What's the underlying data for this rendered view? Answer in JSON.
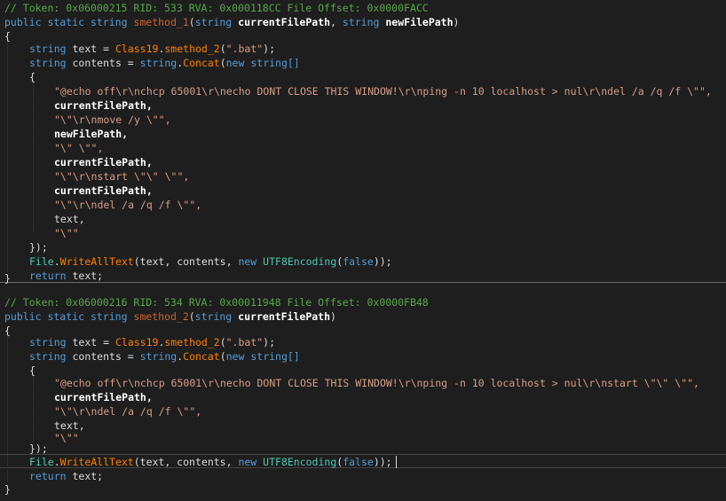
{
  "editor": {
    "current_line_highlight": "line-31",
    "blocks": [
      {
        "token_comment": "// Token: 0x06000215 RID: 533 RVA: 0x000118CC File Offset: 0x0000FACC",
        "signature": {
          "modifiers": "public static",
          "return_type": "string",
          "name": "smethod_1",
          "params": [
            {
              "type": "string",
              "name": "currentFilePath"
            },
            {
              "type": "string",
              "name": "newFilePath"
            }
          ]
        },
        "text_assign": {
          "type": "string",
          "var": "text",
          "class": "Class19",
          "method": "smethod_2",
          "arg": "\".bat\""
        },
        "contents_decl": {
          "type": "string",
          "var": "contents",
          "class": "string",
          "method": "Concat",
          "newkw": "new",
          "arrtype": "string[]"
        },
        "concat_items": [
          {
            "kind": "str",
            "value": "\"@echo off\\r\\nchcp 65001\\r\\necho DONT CLOSE THIS WINDOW!\\r\\nping -n 10 localhost > nul\\r\\ndel /a /q /f \\\"\","
          },
          {
            "kind": "param",
            "value": "currentFilePath,"
          },
          {
            "kind": "str",
            "value": "\"\\\"\\r\\nmove /y \\\"\","
          },
          {
            "kind": "param",
            "value": "newFilePath,"
          },
          {
            "kind": "str",
            "value": "\"\\\" \\\"\","
          },
          {
            "kind": "param",
            "value": "currentFilePath,"
          },
          {
            "kind": "str",
            "value": "\"\\\"\\r\\nstart \\\"\\\" \\\"\","
          },
          {
            "kind": "param",
            "value": "currentFilePath,"
          },
          {
            "kind": "str",
            "value": "\"\\\"\\r\\ndel /a /q /f \\\"\","
          },
          {
            "kind": "var",
            "value": "text,"
          },
          {
            "kind": "str",
            "value": "\"\\\"\""
          }
        ],
        "write_call": {
          "class": "File",
          "method": "WriteAllText",
          "args": "(text, contents,",
          "newkw": "new",
          "enc": "UTF8Encoding",
          "flag": "false",
          "end": "));"
        },
        "return_stmt": {
          "kw": "return",
          "value": "text;"
        }
      },
      {
        "token_comment": "// Token: 0x06000216 RID: 534 RVA: 0x00011948 File Offset: 0x0000FB48",
        "signature": {
          "modifiers": "public static",
          "return_type": "string",
          "name": "smethod_2",
          "params": [
            {
              "type": "string",
              "name": "currentFilePath"
            }
          ]
        },
        "text_assign": {
          "type": "string",
          "var": "text",
          "class": "Class19",
          "method": "smethod_2",
          "arg": "\".bat\""
        },
        "contents_decl": {
          "type": "string",
          "var": "contents",
          "class": "string",
          "method": "Concat",
          "newkw": "new",
          "arrtype": "string[]"
        },
        "concat_items": [
          {
            "kind": "str",
            "value": "\"@echo off\\r\\nchcp 65001\\r\\necho DONT CLOSE THIS WINDOW!\\r\\nping -n 10 localhost > nul\\r\\nstart \\\"\\\" \\\"\","
          },
          {
            "kind": "param",
            "value": "currentFilePath,"
          },
          {
            "kind": "str",
            "value": "\"\\\"\\r\\ndel /a /q /f \\\"\","
          },
          {
            "kind": "var",
            "value": "text,"
          },
          {
            "kind": "str",
            "value": "\"\\\"\""
          }
        ],
        "write_call": {
          "class": "File",
          "method": "WriteAllText",
          "args": "(text, contents,",
          "newkw": "new",
          "enc": "UTF8Encoding",
          "flag": "false",
          "end": "));"
        },
        "return_stmt": {
          "kw": "return",
          "value": "text;"
        }
      }
    ],
    "punct": {
      "open_brace": "{",
      "close_brace": "}",
      "close_concat": "});",
      "eq": " = ",
      "open_paren": "(",
      "close_paren_semi": ");",
      "comma": ", ",
      "close_paren": ")",
      "dot": "."
    }
  }
}
